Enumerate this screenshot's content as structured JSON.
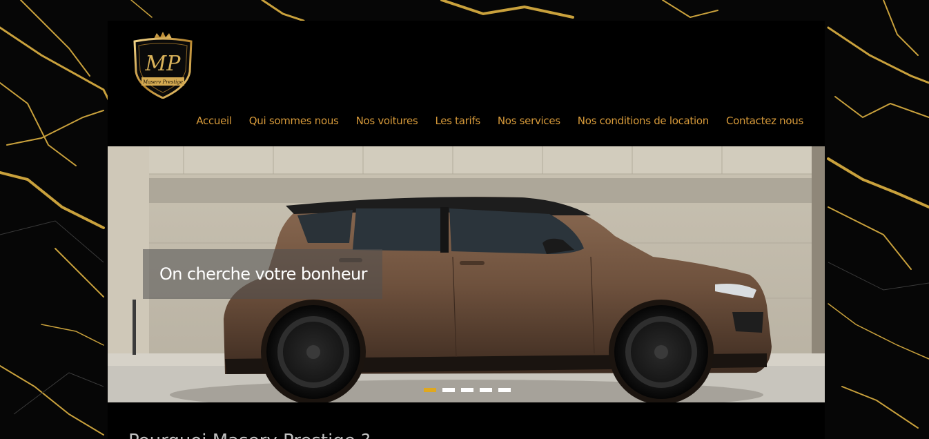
{
  "logo": {
    "initials": "MP",
    "brand": "Maserv Prestige"
  },
  "nav": {
    "items": [
      {
        "label": "Accueil"
      },
      {
        "label": "Qui sommes nous"
      },
      {
        "label": "Nos voitures"
      },
      {
        "label": "Les tarifs"
      },
      {
        "label": "Nos services"
      },
      {
        "label": "Nos conditions de location"
      },
      {
        "label": "Contactez nous"
      }
    ]
  },
  "slider": {
    "caption": "On cherche votre bonheur",
    "slide_count": 5,
    "active_slide": 1
  },
  "intro": {
    "heading": "Pourquoi Maserv Prestige ?"
  },
  "colors": {
    "nav_link": "#d79a3a",
    "accent_gold": "#e0a81e",
    "page_bg": "#000000"
  }
}
